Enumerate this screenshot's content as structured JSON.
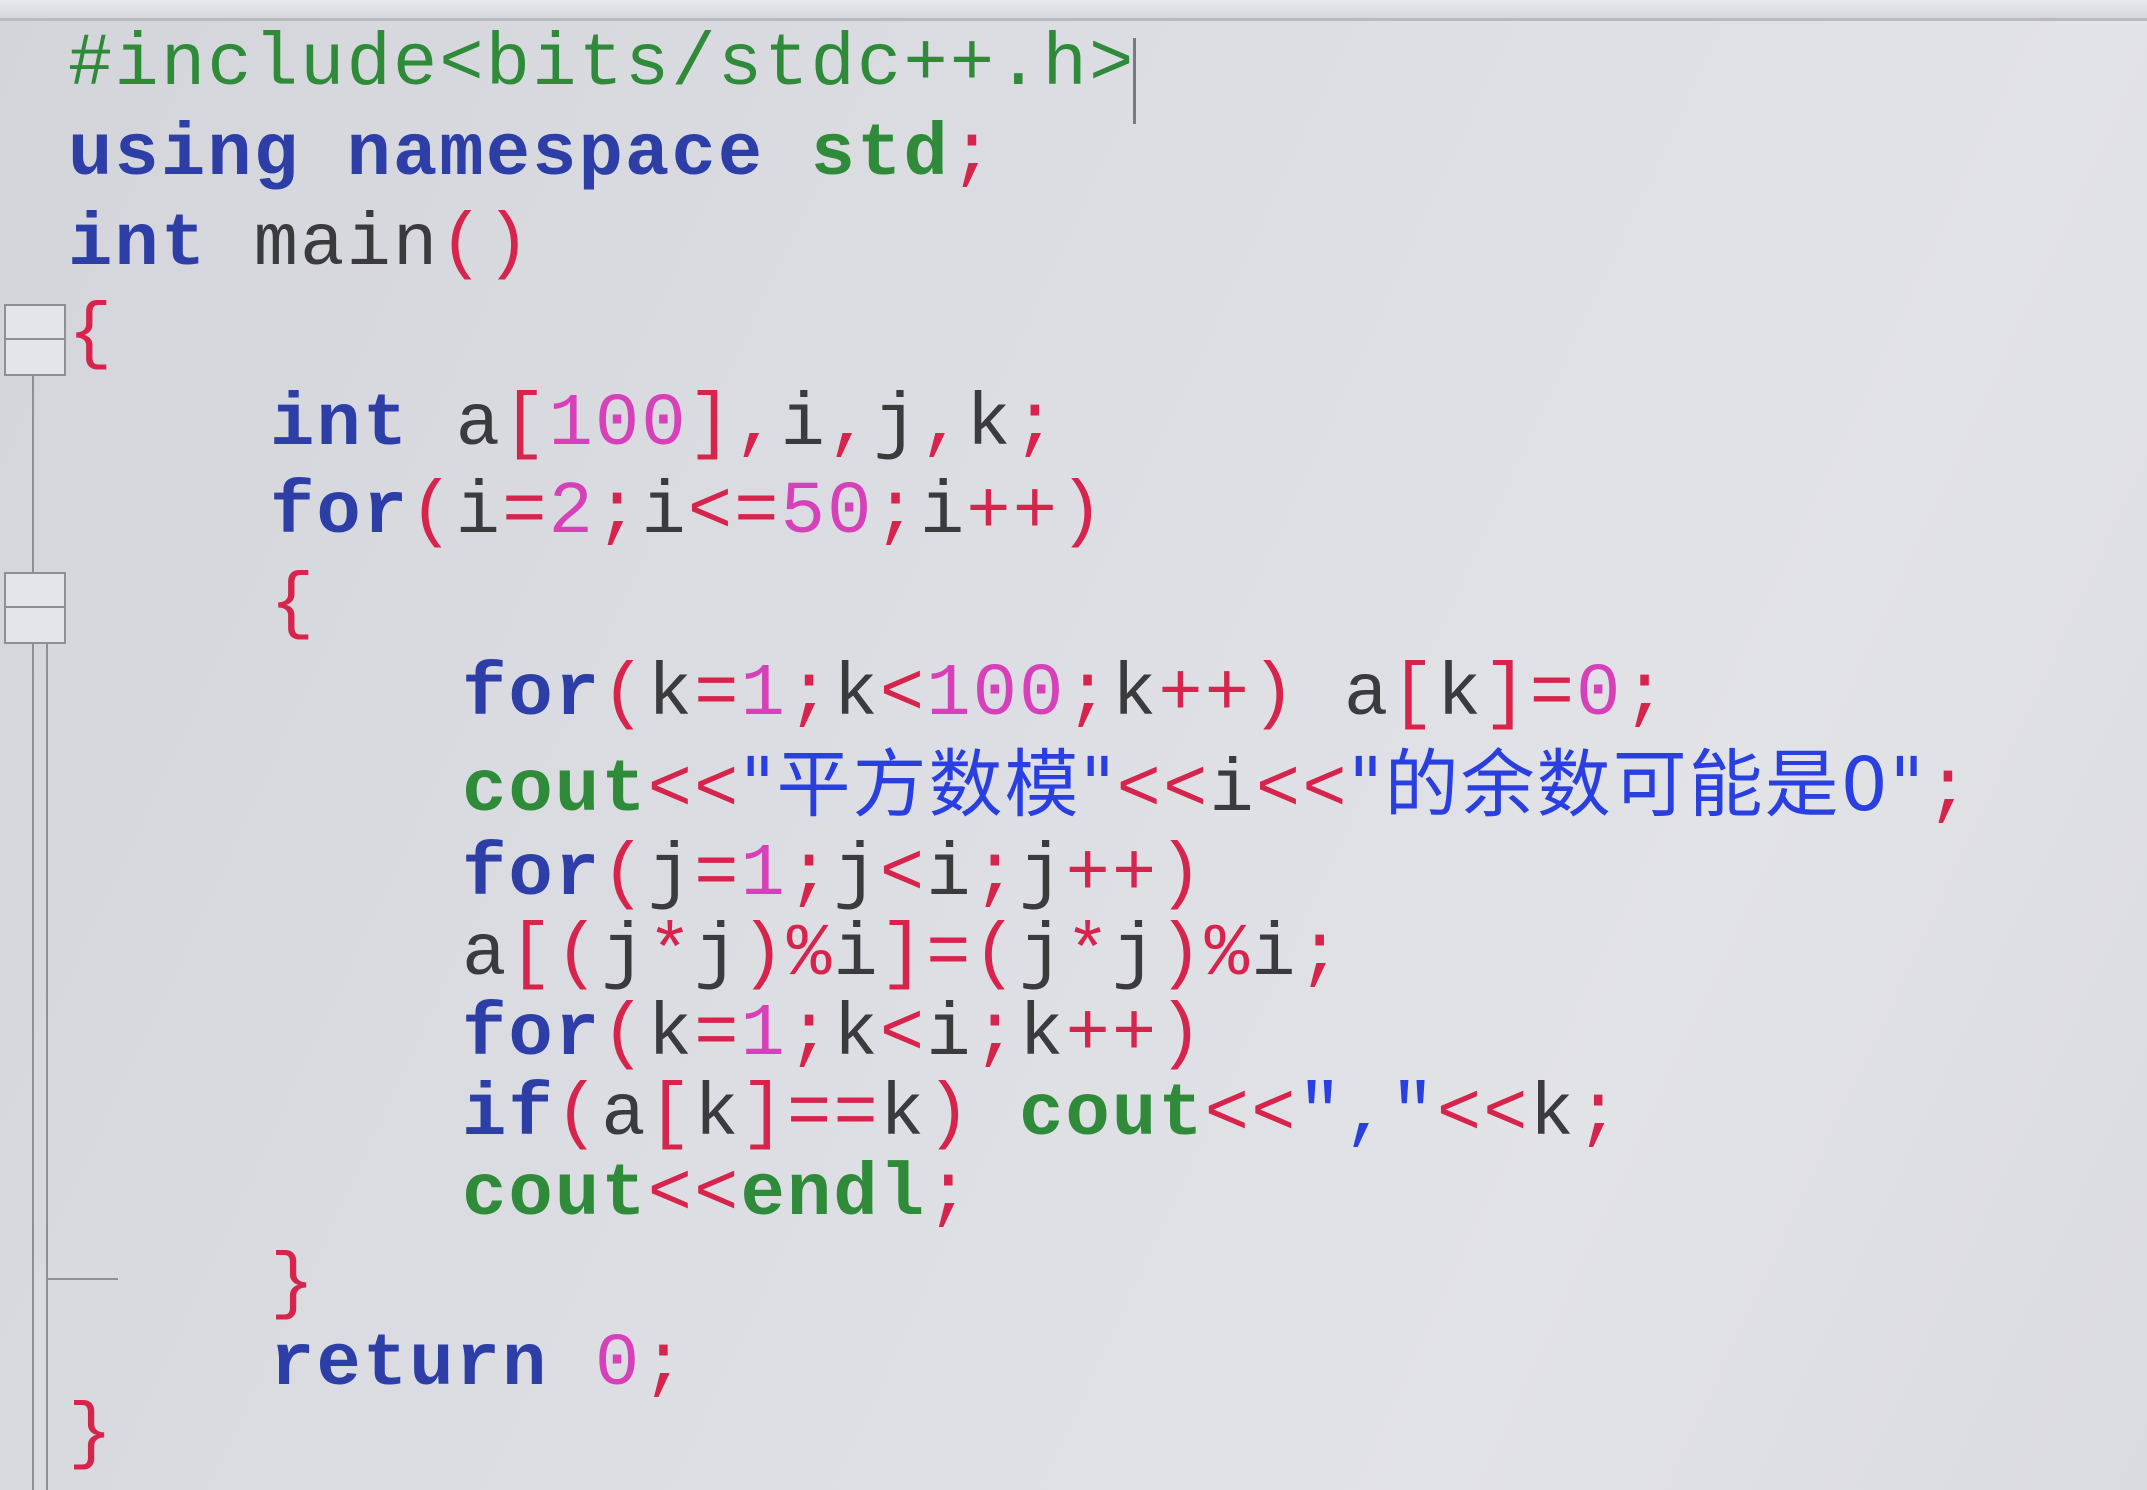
{
  "editor": {
    "lines": [
      {
        "indent": 0,
        "tokens": [
          {
            "t": "#include<bits/stdc++.h>",
            "c": "pp"
          }
        ]
      },
      {
        "indent": 0,
        "tokens": [
          {
            "t": "using",
            "c": "kw"
          },
          {
            "t": " ",
            "c": "id"
          },
          {
            "t": "namespace",
            "c": "kw"
          },
          {
            "t": " ",
            "c": "id"
          },
          {
            "t": "std",
            "c": "std"
          },
          {
            "t": ";",
            "c": "sym"
          }
        ]
      },
      {
        "indent": 0,
        "tokens": [
          {
            "t": "int",
            "c": "kw"
          },
          {
            "t": " main",
            "c": "id"
          },
          {
            "t": "()",
            "c": "sym"
          }
        ]
      },
      {
        "indent": 0,
        "tokens": [
          {
            "t": "{",
            "c": "sym"
          }
        ]
      },
      {
        "indent": 1,
        "tokens": [
          {
            "t": "int",
            "c": "kw"
          },
          {
            "t": " a",
            "c": "id"
          },
          {
            "t": "[",
            "c": "sym"
          },
          {
            "t": "100",
            "c": "num"
          },
          {
            "t": "],",
            "c": "sym"
          },
          {
            "t": "i",
            "c": "id"
          },
          {
            "t": ",",
            "c": "sym"
          },
          {
            "t": "j",
            "c": "id"
          },
          {
            "t": ",",
            "c": "sym"
          },
          {
            "t": "k",
            "c": "id"
          },
          {
            "t": ";",
            "c": "sym"
          }
        ]
      },
      {
        "indent": 1,
        "tokens": [
          {
            "t": "for",
            "c": "kw"
          },
          {
            "t": "(",
            "c": "sym"
          },
          {
            "t": "i",
            "c": "id"
          },
          {
            "t": "=",
            "c": "sym"
          },
          {
            "t": "2",
            "c": "num"
          },
          {
            "t": ";",
            "c": "sym"
          },
          {
            "t": "i",
            "c": "id"
          },
          {
            "t": "<=",
            "c": "sym"
          },
          {
            "t": "50",
            "c": "num"
          },
          {
            "t": ";",
            "c": "sym"
          },
          {
            "t": "i",
            "c": "id"
          },
          {
            "t": "++)",
            "c": "sym"
          }
        ]
      },
      {
        "indent": 1,
        "tokens": [
          {
            "t": "{",
            "c": "sym"
          }
        ]
      },
      {
        "indent": 2,
        "tokens": [
          {
            "t": "for",
            "c": "kw"
          },
          {
            "t": "(",
            "c": "sym"
          },
          {
            "t": "k",
            "c": "id"
          },
          {
            "t": "=",
            "c": "sym"
          },
          {
            "t": "1",
            "c": "num"
          },
          {
            "t": ";",
            "c": "sym"
          },
          {
            "t": "k",
            "c": "id"
          },
          {
            "t": "<",
            "c": "sym"
          },
          {
            "t": "100",
            "c": "num"
          },
          {
            "t": ";",
            "c": "sym"
          },
          {
            "t": "k",
            "c": "id"
          },
          {
            "t": "++)",
            "c": "sym"
          },
          {
            "t": " a",
            "c": "id"
          },
          {
            "t": "[",
            "c": "sym"
          },
          {
            "t": "k",
            "c": "id"
          },
          {
            "t": "]=",
            "c": "sym"
          },
          {
            "t": "0",
            "c": "num"
          },
          {
            "t": ";",
            "c": "sym"
          }
        ]
      },
      {
        "indent": 2,
        "tokens": [
          {
            "t": "cout",
            "c": "std"
          },
          {
            "t": "<<",
            "c": "sym"
          },
          {
            "t": "\"平方数模\"",
            "c": "str"
          },
          {
            "t": "<<",
            "c": "sym"
          },
          {
            "t": "i",
            "c": "id"
          },
          {
            "t": "<<",
            "c": "sym"
          },
          {
            "t": "\"的余数可能是0\"",
            "c": "str"
          },
          {
            "t": ";",
            "c": "sym"
          }
        ]
      },
      {
        "indent": 2,
        "tokens": [
          {
            "t": "for",
            "c": "kw"
          },
          {
            "t": "(",
            "c": "sym"
          },
          {
            "t": "j",
            "c": "id"
          },
          {
            "t": "=",
            "c": "sym"
          },
          {
            "t": "1",
            "c": "num"
          },
          {
            "t": ";",
            "c": "sym"
          },
          {
            "t": "j",
            "c": "id"
          },
          {
            "t": "<",
            "c": "sym"
          },
          {
            "t": "i",
            "c": "id"
          },
          {
            "t": ";",
            "c": "sym"
          },
          {
            "t": "j",
            "c": "id"
          },
          {
            "t": "++)",
            "c": "sym"
          }
        ]
      },
      {
        "indent": 2,
        "tokens": [
          {
            "t": "a",
            "c": "id"
          },
          {
            "t": "[(",
            "c": "sym"
          },
          {
            "t": "j",
            "c": "id"
          },
          {
            "t": "*",
            "c": "sym"
          },
          {
            "t": "j",
            "c": "id"
          },
          {
            "t": ")%",
            "c": "sym"
          },
          {
            "t": "i",
            "c": "id"
          },
          {
            "t": "]=(",
            "c": "sym"
          },
          {
            "t": "j",
            "c": "id"
          },
          {
            "t": "*",
            "c": "sym"
          },
          {
            "t": "j",
            "c": "id"
          },
          {
            "t": ")%",
            "c": "sym"
          },
          {
            "t": "i",
            "c": "id"
          },
          {
            "t": ";",
            "c": "sym"
          }
        ]
      },
      {
        "indent": 2,
        "tokens": [
          {
            "t": "for",
            "c": "kw"
          },
          {
            "t": "(",
            "c": "sym"
          },
          {
            "t": "k",
            "c": "id"
          },
          {
            "t": "=",
            "c": "sym"
          },
          {
            "t": "1",
            "c": "num"
          },
          {
            "t": ";",
            "c": "sym"
          },
          {
            "t": "k",
            "c": "id"
          },
          {
            "t": "<",
            "c": "sym"
          },
          {
            "t": "i",
            "c": "id"
          },
          {
            "t": ";",
            "c": "sym"
          },
          {
            "t": "k",
            "c": "id"
          },
          {
            "t": "++)",
            "c": "sym"
          }
        ]
      },
      {
        "indent": 2,
        "tokens": [
          {
            "t": "if",
            "c": "kw"
          },
          {
            "t": "(",
            "c": "sym"
          },
          {
            "t": "a",
            "c": "id"
          },
          {
            "t": "[",
            "c": "sym"
          },
          {
            "t": "k",
            "c": "id"
          },
          {
            "t": "]==",
            "c": "sym"
          },
          {
            "t": "k",
            "c": "id"
          },
          {
            "t": ")",
            "c": "sym"
          },
          {
            "t": " ",
            "c": "id"
          },
          {
            "t": "cout",
            "c": "std"
          },
          {
            "t": "<<",
            "c": "sym"
          },
          {
            "t": "\",\"",
            "c": "str"
          },
          {
            "t": "<<",
            "c": "sym"
          },
          {
            "t": "k",
            "c": "id"
          },
          {
            "t": ";",
            "c": "sym"
          }
        ]
      },
      {
        "indent": 2,
        "tokens": [
          {
            "t": "cout",
            "c": "std"
          },
          {
            "t": "<<",
            "c": "sym"
          },
          {
            "t": "endl",
            "c": "std"
          },
          {
            "t": ";",
            "c": "sym"
          }
        ]
      },
      {
        "indent": 1,
        "tokens": [
          {
            "t": "}",
            "c": "sym"
          }
        ]
      },
      {
        "indent": 1,
        "tokens": [
          {
            "t": "return",
            "c": "kw"
          },
          {
            "t": " ",
            "c": "id"
          },
          {
            "t": "0",
            "c": "num"
          },
          {
            "t": ";",
            "c": "sym"
          }
        ]
      },
      {
        "indent": 0,
        "tokens": [
          {
            "t": "}",
            "c": "sym"
          }
        ]
      }
    ]
  },
  "colors": {
    "preprocessor": "#2f8b3a",
    "keyword": "#2d3ea6",
    "identifier": "#3b3b3e",
    "symbol": "#d6244c",
    "number": "#d640b8",
    "string": "#2a3fe0",
    "background": "#dcdee3"
  }
}
